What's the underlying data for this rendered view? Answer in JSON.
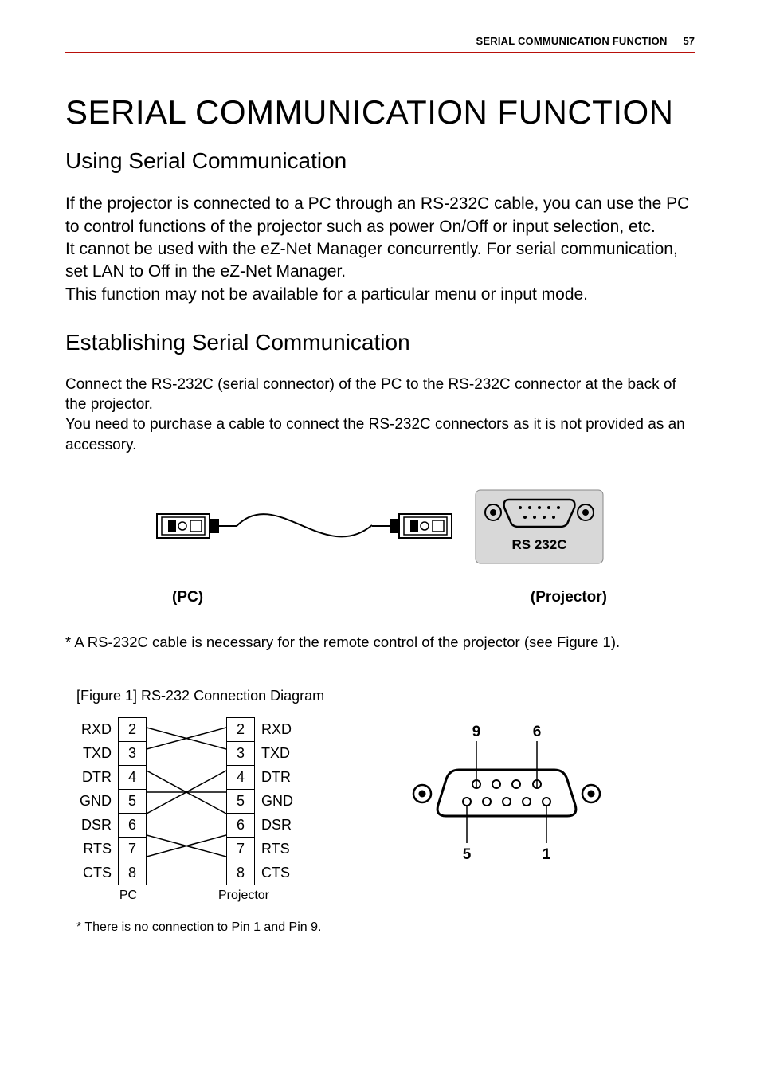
{
  "header": {
    "running_title": "SERIAL COMMUNICATION FUNCTION",
    "page_number": "57"
  },
  "title": "SERIAL COMMUNICATION FUNCTION",
  "section1": {
    "heading": "Using Serial Communication",
    "body": "If the projector is connected to a PC through an RS-232C cable, you can use the PC to control functions of the projector such as power On/Off or input selection, etc.\nIt cannot be used with the eZ-Net Manager concurrently. For serial communication, set LAN to Off in the eZ-Net Manager.\nThis function may not be available for a particular menu or input mode."
  },
  "section2": {
    "heading": "Establishing Serial Communication",
    "body": "Connect the RS-232C (serial connector) of the PC to the RS-232C connector at the back of the projector.\nYou need to purchase a cable to connect the RS-232C connectors as it is not provided as an accessory."
  },
  "diagram": {
    "port_label": "RS 232C",
    "label_pc": "(PC)",
    "label_projector": "(Projector)"
  },
  "note_cable": "* A RS-232C cable is necessary for the remote control of the projector (see Figure 1).",
  "figure1": {
    "caption": "[Figure 1] RS-232 Connection Diagram",
    "rows": [
      {
        "sig": "RXD",
        "l": "2",
        "r": "2"
      },
      {
        "sig": "TXD",
        "l": "3",
        "r": "3"
      },
      {
        "sig": "DTR",
        "l": "4",
        "r": "4"
      },
      {
        "sig": "GND",
        "l": "5",
        "r": "5"
      },
      {
        "sig": "DSR",
        "l": "6",
        "r": "6"
      },
      {
        "sig": "RTS",
        "l": "7",
        "r": "7"
      },
      {
        "sig": "CTS",
        "l": "8",
        "r": "8"
      }
    ],
    "footer_left": "PC",
    "footer_right": "Projector",
    "db9_pins": {
      "top_left": "9",
      "top_right": "6",
      "bot_left": "5",
      "bot_right": "1"
    }
  },
  "note_pin": "* There is no connection to Pin 1 and Pin 9."
}
